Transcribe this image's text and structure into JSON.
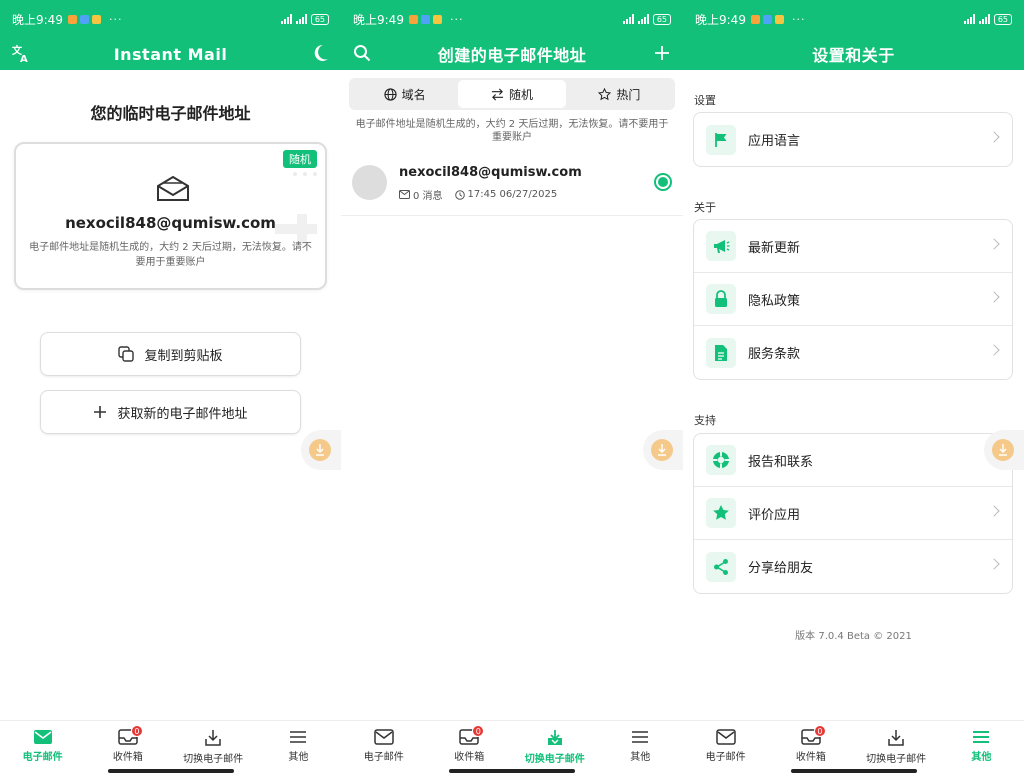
{
  "status": {
    "time": "晚上9:49",
    "dots": "···",
    "battery": "65"
  },
  "colors": {
    "accent": "#12c07a",
    "badge_red": "#e53935"
  },
  "screen1": {
    "title": "Instant Mail",
    "heading": "您的临时电子邮件地址",
    "badge": "随机",
    "email": "nexocil848@qumisw.com",
    "note": "电子邮件地址是随机生成的，大约 2 天后过期，无法恢复。请不要用于重要账户",
    "copy_label": "复制到剪贴板",
    "new_label": "获取新的电子邮件地址"
  },
  "screen2": {
    "title": "创建的电子邮件地址",
    "tabs": [
      {
        "label": "域名",
        "icon": "globe-icon"
      },
      {
        "label": "随机",
        "icon": "swap-icon"
      },
      {
        "label": "热门",
        "icon": "star-outline-icon"
      }
    ],
    "note": "电子邮件地址是随机生成的，大约 2 天后过期，无法恢复。请不要用于重要账户",
    "row": {
      "email": "nexocil848@qumisw.com",
      "messages": "0 消息",
      "time": "17:45 06/27/2025"
    }
  },
  "screen3": {
    "title": "设置和关于",
    "sections": {
      "settings": "设置",
      "about": "关于",
      "support": "支持"
    },
    "settings_items": [
      {
        "label": "应用语言",
        "icon": "flag-icon"
      }
    ],
    "about_items": [
      {
        "label": "最新更新",
        "icon": "megaphone-icon"
      },
      {
        "label": "隐私政策",
        "icon": "lock-icon"
      },
      {
        "label": "服务条款",
        "icon": "document-icon"
      }
    ],
    "support_items": [
      {
        "label": "报告和联系",
        "icon": "lifebuoy-icon"
      },
      {
        "label": "评价应用",
        "icon": "star-icon"
      },
      {
        "label": "分享给朋友",
        "icon": "share-icon"
      }
    ],
    "version": "版本 7.0.4 Beta © 2021"
  },
  "nav": {
    "mail": "电子邮件",
    "inbox": "收件箱",
    "inbox_badge": "0",
    "switch": "切换电子邮件",
    "other": "其他"
  }
}
